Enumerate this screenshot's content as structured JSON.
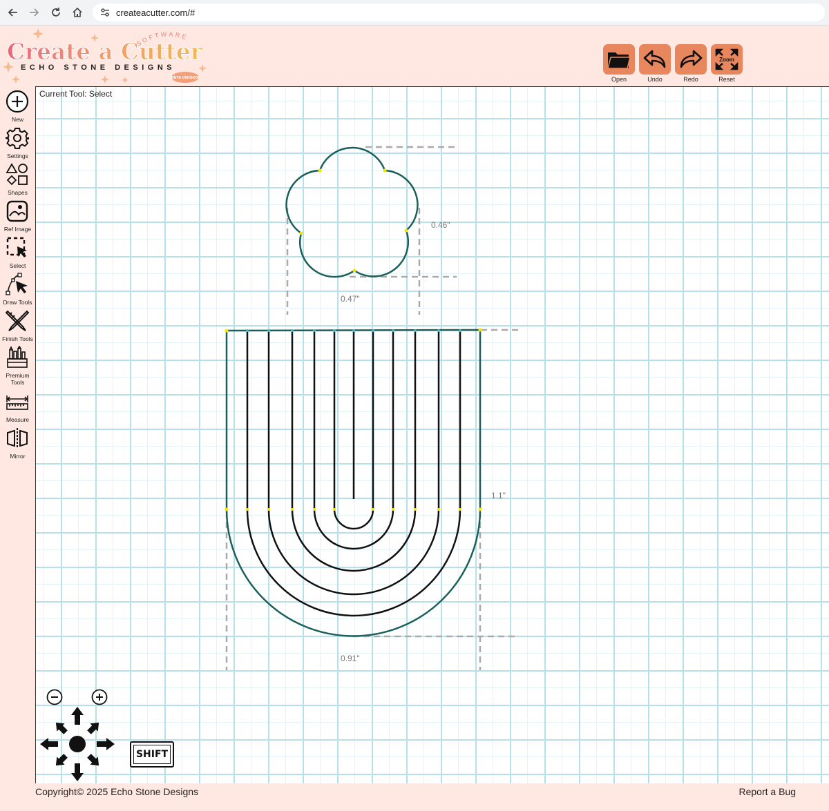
{
  "browser": {
    "url": "createacutter.com/#",
    "back_icon": "arrow-left-icon",
    "forward_icon": "arrow-right-icon",
    "reload_icon": "reload-icon",
    "home_icon": "home-icon"
  },
  "header": {
    "logo": {
      "title": "Create a Cutter",
      "arc_text": "SOFTWARE",
      "subtitle": "ECHO STONE DESIGNS",
      "badge": "BETA VERSION"
    },
    "buttons": [
      {
        "label": "Open",
        "icon": "folder-icon"
      },
      {
        "label": "Undo",
        "icon": "undo-icon"
      },
      {
        "label": "Redo",
        "icon": "redo-icon"
      },
      {
        "label": "Reset",
        "icon": "zoom-reset-icon",
        "icon_text": "Zoom"
      }
    ]
  },
  "sidebar": {
    "items": [
      {
        "label": "New",
        "icon": "plus-circle-icon"
      },
      {
        "label": "Settings",
        "icon": "gear-icon"
      },
      {
        "label": "Shapes",
        "icon": "shapes-icon"
      },
      {
        "label": "Ref Image",
        "icon": "image-icon"
      },
      {
        "label": "Select",
        "icon": "select-icon"
      },
      {
        "label": "Draw Tools",
        "icon": "draw-tools-icon"
      },
      {
        "label": "Finish Tools",
        "icon": "finish-tools-icon"
      },
      {
        "label": "Premium Tools",
        "icon": "premium-tools-icon"
      },
      {
        "label": "Measure",
        "icon": "ruler-icon"
      },
      {
        "label": "Mirror",
        "icon": "mirror-icon"
      }
    ]
  },
  "canvas": {
    "current_tool": "Current Tool: Select",
    "flower": {
      "width_label": "0.47\"",
      "height_label": "0.46\""
    },
    "arch": {
      "width_label": "0.91\"",
      "height_label": "1.1\""
    },
    "outline_color": "#1a5f5a"
  },
  "controls": {
    "zoom_out_icon": "zoom-out-icon",
    "zoom_in_icon": "zoom-in-icon",
    "pan_icon": "pan-arrows-icon",
    "shift_label": "SHIFT"
  },
  "footer": {
    "copyright": "Copyright© 2025 Echo Stone Designs",
    "report_bug": "Report a Bug"
  }
}
